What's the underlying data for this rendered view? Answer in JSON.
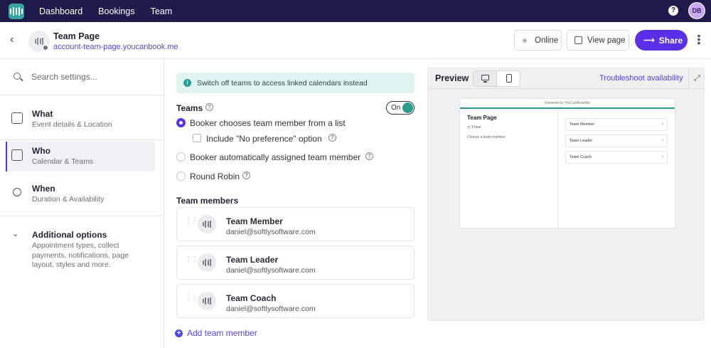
{
  "nav": {
    "items": [
      "Dashboard",
      "Bookings",
      "Team"
    ],
    "help": "?",
    "avatar_initials": "DB"
  },
  "header": {
    "title": "Team Page",
    "url": "account-team-page.youcanbook.me",
    "online_label": "Online",
    "view_label": "View page",
    "share_label": "Share"
  },
  "sidebar": {
    "search_placeholder": "Search settings...",
    "items": [
      {
        "title": "What",
        "subtitle": "Event details & Location",
        "icon": "document-icon"
      },
      {
        "title": "Who",
        "subtitle": "Calendar & Teams",
        "icon": "person-card-icon",
        "active": true
      },
      {
        "title": "When",
        "subtitle": "Duration & Availability",
        "icon": "watch-icon"
      }
    ],
    "additional": {
      "title": "Additional options",
      "subtitle": "Appointment types, collect payments, notifications, page layout, styles and more."
    }
  },
  "main": {
    "banner": "Switch off teams to access linked calendars instead",
    "teams_label": "Teams",
    "toggle_label": "On",
    "options": [
      "Booker chooses team member from a list",
      "Include \"No preference\" option",
      "Booker automatically assigned team member",
      "Round Robin"
    ],
    "team_members_label": "Team members",
    "members": [
      {
        "name": "Team Member",
        "email": "daniel@softlysoftware.com"
      },
      {
        "name": "Team Leader",
        "email": "daniel@softlysoftware.com"
      },
      {
        "name": "Team Coach",
        "email": "daniel@softlysoftware.com"
      }
    ],
    "add_member": "Add team member"
  },
  "preview": {
    "title": "Preview",
    "troubleshoot": "Troubleshoot availability",
    "powered_by": "Powered by YouCanBookMe",
    "page_title": "Team Page",
    "duration": "1 hour",
    "choose_text": "Choose a team member.",
    "items": [
      "Team Member",
      "Team Leader",
      "Team Coach"
    ]
  },
  "colors": {
    "nav_bg": "#1e1b4b",
    "accent": "#5b2eea",
    "link": "#4f46e5",
    "teal": "#2a9d8f"
  }
}
